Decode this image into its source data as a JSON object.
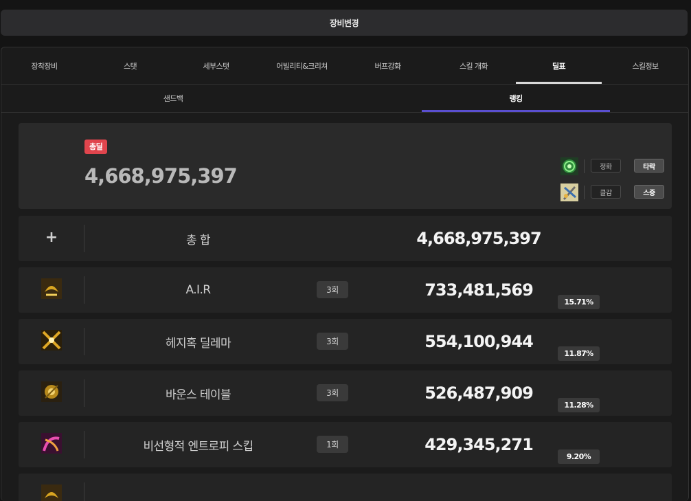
{
  "header": {
    "title": "장비변경"
  },
  "main_tabs": [
    {
      "label": "장착장비"
    },
    {
      "label": "스탯"
    },
    {
      "label": "세부스탯"
    },
    {
      "label": "어빌리티&크리쳐"
    },
    {
      "label": "버프강화"
    },
    {
      "label": "스킬 개화"
    },
    {
      "label": "딜표"
    },
    {
      "label": "스킬정보"
    }
  ],
  "active_main_tab": "딜표",
  "sub_tabs": [
    {
      "label": "샌드백"
    },
    {
      "label": "랭킹"
    }
  ],
  "active_sub_tab": "랭킹",
  "summary": {
    "badge": "총딜",
    "total": "4,668,975,397",
    "options": [
      {
        "icon": "green-swirl-icon",
        "label": "정화",
        "selected": "타락"
      },
      {
        "icon": "skill-weapon-icon",
        "label": "클감",
        "selected": "스증"
      }
    ]
  },
  "total_row": {
    "icon": "plus-icon",
    "name": "총 합",
    "damage": "4,668,975,397"
  },
  "skills": [
    {
      "icon": "air-skill-icon",
      "name": "A.I.R",
      "count": "3회",
      "damage": "733,481,569",
      "percent": "15.71%"
    },
    {
      "icon": "hedgehog-skill-icon",
      "name": "헤지혹 딜레마",
      "count": "3회",
      "damage": "554,100,944",
      "percent": "11.87%"
    },
    {
      "icon": "bounce-skill-icon",
      "name": "바운스 테이블",
      "count": "3회",
      "damage": "526,487,909",
      "percent": "11.28%"
    },
    {
      "icon": "entropy-skill-icon",
      "name": "비선형적 엔트로피 스킵",
      "count": "1회",
      "damage": "429,345,271",
      "percent": "9.20%"
    }
  ],
  "colors": {
    "accent_sub_tab": "#5a4fd0",
    "badge_red": "#e0454d",
    "background": "#141414"
  }
}
